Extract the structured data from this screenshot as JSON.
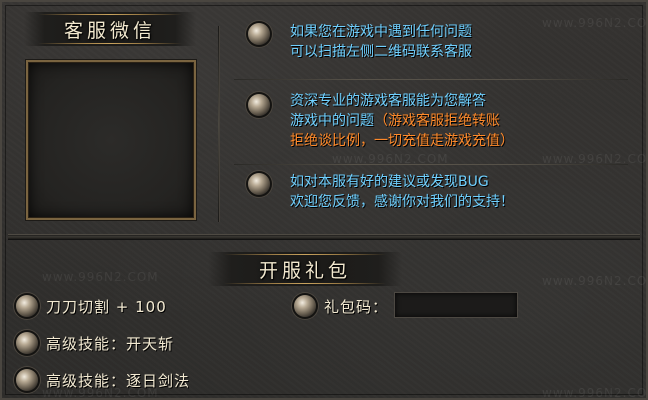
{
  "colors": {
    "info_text": "#6fd0ff",
    "warning_text": "#ff8a2a",
    "label_text": "#f3ead2",
    "frame_gold": "#7a6440",
    "background": "#33312f"
  },
  "service": {
    "title": "客服微信",
    "items": [
      {
        "icon": "rivet-bullet-icon",
        "lines": [
          "如果您在游戏中遇到任何问题",
          "可以扫描左侧二维码联系客服"
        ]
      },
      {
        "icon": "rivet-bullet-icon",
        "line1": "资深专业的游戏客服能为您解答",
        "line2_prefix": "游戏中的问题",
        "line2_warning": "（游戏客服拒绝转账",
        "line3_warning": "拒绝谈比例，一切充值走游戏充值）"
      },
      {
        "icon": "rivet-bullet-icon",
        "lines": [
          "如对本服有好的建议或发现BUG",
          "欢迎您反馈，感谢你对我们的支持！"
        ]
      }
    ]
  },
  "gift_pack": {
    "title": "开服礼包",
    "rewards": [
      {
        "icon": "rivet-bullet-icon",
        "label": "刀刀切割 + 100"
      },
      {
        "icon": "rivet-bullet-icon",
        "label": "高级技能：开天斩"
      },
      {
        "icon": "rivet-bullet-icon",
        "label": "高级技能：逐日剑法"
      }
    ],
    "code_label": "礼包码：",
    "code_value": ""
  },
  "watermark": "www.996N2.COM"
}
